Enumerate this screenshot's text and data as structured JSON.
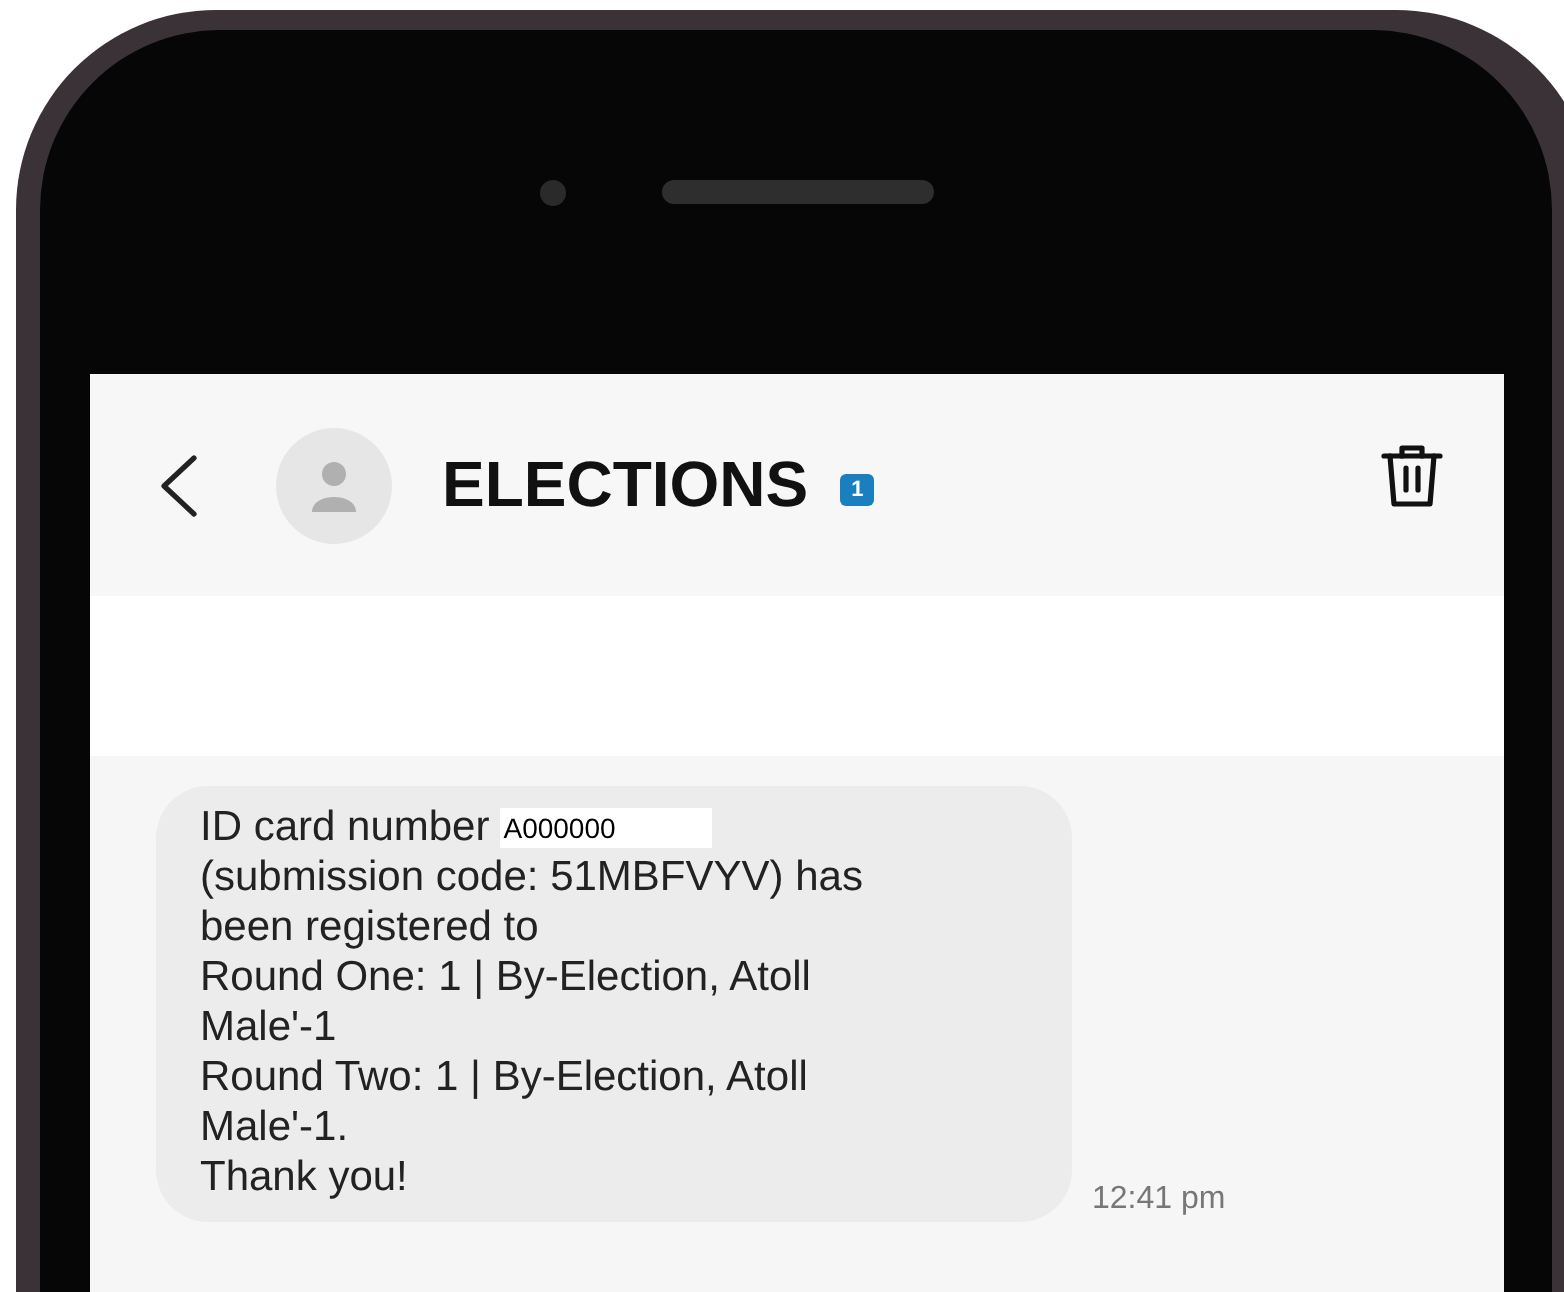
{
  "header": {
    "title": "ELECTIONS",
    "badge": "1"
  },
  "message": {
    "prefix": "ID card number",
    "id_value": "A000000",
    "body": "(submission code: 51MBFVYV) has\nbeen registered to\nRound One: 1 | By-Election, Atoll\nMale'-1\nRound Two: 1 | By-Election, Atoll\nMale'-1.\nThank you!",
    "time": "12:41 pm"
  }
}
